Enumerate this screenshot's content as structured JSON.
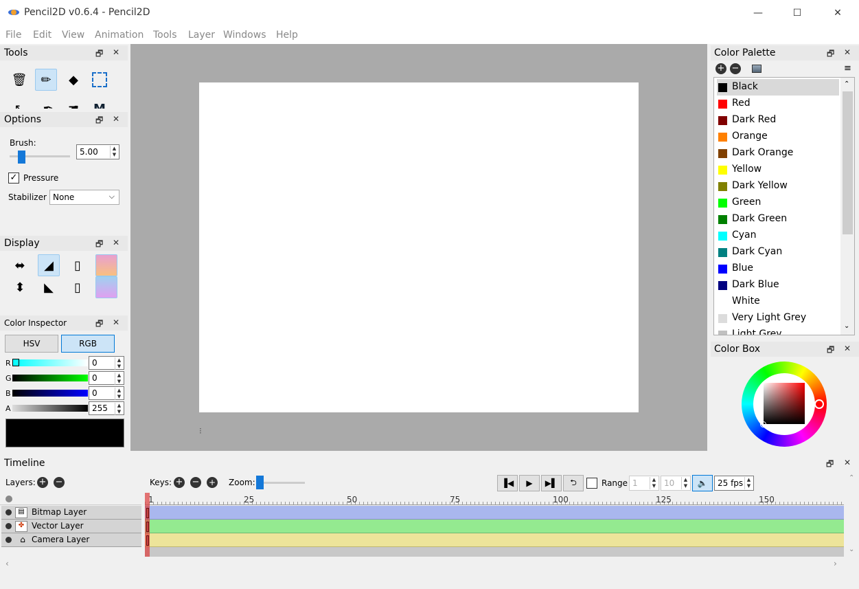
{
  "window": {
    "title": "Pencil2D v0.6.4 - Pencil2D",
    "min": "—",
    "max": "☐",
    "close": "✕"
  },
  "menu": [
    "File",
    "Edit",
    "View",
    "Animation",
    "Tools",
    "Layer",
    "Windows",
    "Help"
  ],
  "tools_panel": {
    "title": "Tools"
  },
  "options_panel": {
    "title": "Options",
    "brush_label": "Brush:",
    "brush_value": "5.00",
    "pressure_label": "Pressure",
    "stabilizer_label": "Stabilizer",
    "stabilizer_value": "None"
  },
  "display_panel": {
    "title": "Display"
  },
  "color_inspector": {
    "title": "Color Inspector",
    "tab_hsv": "HSV",
    "tab_rgb": "RGB",
    "channels": [
      {
        "label": "R",
        "value": "0"
      },
      {
        "label": "G",
        "value": "0"
      },
      {
        "label": "B",
        "value": "0"
      },
      {
        "label": "A",
        "value": "255"
      }
    ],
    "current_color": "#000000"
  },
  "color_palette": {
    "title": "Color Palette",
    "items": [
      {
        "name": "Black",
        "color": "#000000"
      },
      {
        "name": "Red",
        "color": "#ff0000"
      },
      {
        "name": "Dark Red",
        "color": "#800000"
      },
      {
        "name": "Orange",
        "color": "#ff8000"
      },
      {
        "name": "Dark Orange",
        "color": "#804000"
      },
      {
        "name": "Yellow",
        "color": "#ffff00"
      },
      {
        "name": "Dark Yellow",
        "color": "#808000"
      },
      {
        "name": "Green",
        "color": "#00ff00"
      },
      {
        "name": "Dark Green",
        "color": "#008000"
      },
      {
        "name": "Cyan",
        "color": "#00ffff"
      },
      {
        "name": "Dark Cyan",
        "color": "#008080"
      },
      {
        "name": "Blue",
        "color": "#0000ff"
      },
      {
        "name": "Dark Blue",
        "color": "#000080"
      },
      {
        "name": "White",
        "color": "#ffffff"
      },
      {
        "name": "Very Light Grey",
        "color": "#dcdcdc"
      },
      {
        "name": "Light Grey",
        "color": "#c0c0c0"
      }
    ]
  },
  "color_box": {
    "title": "Color Box"
  },
  "timeline": {
    "title": "Timeline",
    "layers_label": "Layers:",
    "keys_label": "Keys:",
    "zoom_label": "Zoom:",
    "range_label": "Range",
    "range_start": "1",
    "range_end": "10",
    "fps": "25 fps",
    "ruler": [
      "1",
      "25",
      "50",
      "75",
      "100",
      "125",
      "150"
    ],
    "layers": [
      {
        "name": "Bitmap Layer",
        "color": "#a9b7ee"
      },
      {
        "name": "Vector Layer",
        "color": "#94ea90"
      },
      {
        "name": "Camera Layer",
        "color": "#ede49a"
      }
    ]
  }
}
